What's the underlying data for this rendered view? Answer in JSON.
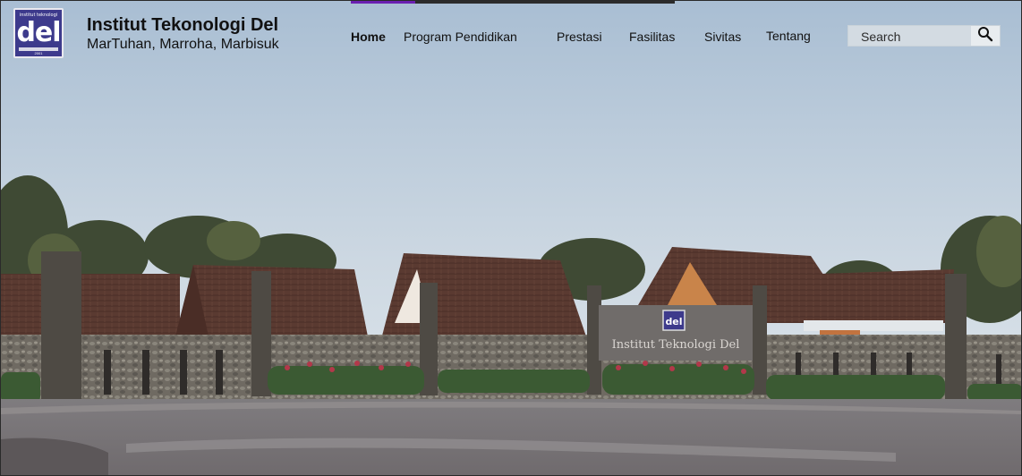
{
  "brand": {
    "title": "Institut Tekonologi Del",
    "subtitle": "MarTuhan, Marroha, Marbisuk",
    "logo_text": "del",
    "logo_small_text": "institut teknologi",
    "logo_year": "2001"
  },
  "nav": {
    "items": [
      {
        "label": "Home",
        "active": true
      },
      {
        "label": "Program Pendidikan",
        "active": false
      },
      {
        "label": "Prestasi",
        "active": false
      },
      {
        "label": "Fasilitas",
        "active": false
      },
      {
        "label": "Sivitas",
        "active": false
      },
      {
        "label": "Tentang",
        "active": false
      }
    ]
  },
  "search": {
    "placeholder": "Search",
    "button_icon": "search-icon"
  },
  "hero": {
    "sign_text": "Institut Teknologi Del",
    "sign_logo": "del"
  },
  "progress": {
    "value_percent": 20
  },
  "colors": {
    "accent": "#6a1fb0",
    "logo_bg": "#3d3a8c",
    "sky_top": "#aabfd4",
    "sky_bottom": "#dde6ec"
  }
}
